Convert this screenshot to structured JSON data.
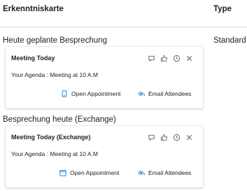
{
  "columns": {
    "card": "Erkenntniskarte",
    "type": "Type"
  },
  "rows": [
    {
      "section_title": "Heute geplante Besprechung",
      "type_value": "Standard",
      "card": {
        "title": "Meeting Today",
        "body": "Your Agenda : Meeting at 10 A.M",
        "open_label": "Open Appointment",
        "email_label": "Email Attendees",
        "open_icon": "phone-icon"
      }
    },
    {
      "section_title": "Besprechung heute (Exchange)",
      "type_value": "",
      "card": {
        "title": "Meeting Today (Exchange)",
        "body": "Your Agenda : Meeting at 10 A.M",
        "open_label": "Open Appointment",
        "email_label": "Email Attendees",
        "open_icon": "calendar-icon"
      }
    }
  ],
  "colors": {
    "accent": "#0078d4",
    "text": "#201f1e",
    "icon": "#605e5c"
  }
}
